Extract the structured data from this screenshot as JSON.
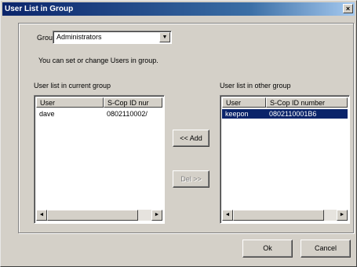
{
  "window": {
    "title": "User List in Group",
    "close_glyph": "×"
  },
  "group": {
    "label": "Group:",
    "selected": "Administrators",
    "dropdown_glyph": "▼"
  },
  "hint": "You can set or change Users in group.",
  "current_list": {
    "label": "User list in current group",
    "columns": [
      "User",
      "S-Cop ID nur"
    ],
    "rows": [
      {
        "user": "dave",
        "id": "0802110002/"
      }
    ]
  },
  "other_list": {
    "label": "User list in other group",
    "columns": [
      "User",
      "S-Cop ID number"
    ],
    "rows": [
      {
        "user": "keepon",
        "id": "0802110001B6",
        "selected": true
      }
    ]
  },
  "scroll_glyphs": {
    "left": "◄",
    "right": "►"
  },
  "buttons": {
    "add": "<< Add",
    "del": "Del >>",
    "ok": "Ok",
    "cancel": "Cancel"
  },
  "colors": {
    "selection": "#0a246a",
    "face": "#d4d0c8",
    "title_start": "#0a246a"
  }
}
